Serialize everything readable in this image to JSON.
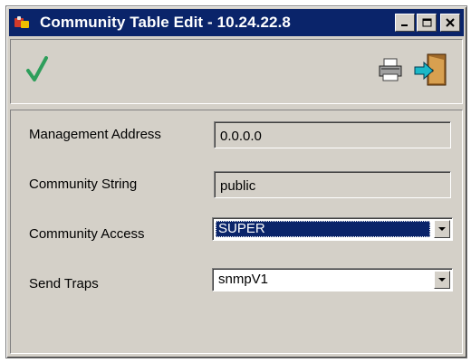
{
  "window": {
    "title": "Community Table Edit - 10.24.22.8",
    "controls": [
      "minimize-icon",
      "maximize-icon",
      "close-icon"
    ]
  },
  "toolbar": {
    "ok_icon": "checkmark-icon",
    "print_icon": "printer-icon",
    "exit_icon": "exit-door-icon"
  },
  "form": {
    "management_address": {
      "label": "Management Address",
      "value": "0.0.0.0"
    },
    "community_string": {
      "label": "Community String",
      "value": "public"
    },
    "community_access": {
      "label": "Community Access",
      "value": "SUPER"
    },
    "send_traps": {
      "label": "Send Traps",
      "value": "snmpV1"
    }
  },
  "colors": {
    "titlebar": "#0a246a",
    "face": "#d4d0c8",
    "check": "#2e9e5b"
  }
}
